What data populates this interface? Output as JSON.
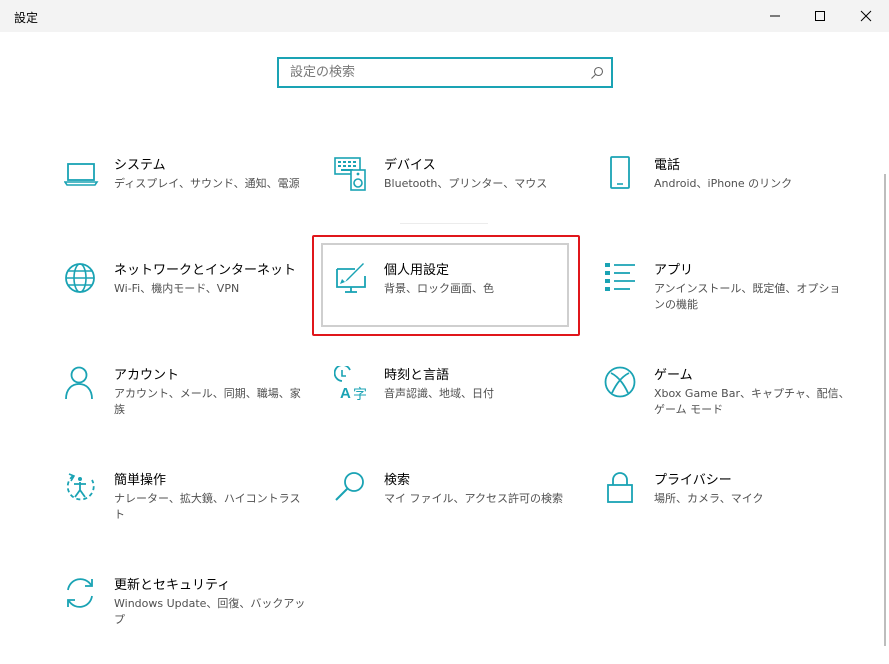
{
  "window": {
    "title": "設定",
    "minimize_icon": "minimize-icon",
    "maximize_icon": "maximize-icon",
    "close_icon": "close-icon"
  },
  "search": {
    "placeholder": "設定の検索",
    "value": "",
    "icon": "search-icon"
  },
  "accent_color": "#1aa3b4",
  "highlight_color": "#e0161b",
  "tiles": [
    {
      "title": "システム",
      "desc": "ディスプレイ、サウンド、通知、電源",
      "icon": "laptop-icon"
    },
    {
      "title": "デバイス",
      "desc": "Bluetooth、プリンター、マウス",
      "icon": "keyboard-speaker-icon"
    },
    {
      "title": "電話",
      "desc": "Android、iPhone のリンク",
      "icon": "phone-icon"
    },
    {
      "title": "ネットワークとインターネット",
      "desc": "Wi-Fi、機内モード、VPN",
      "icon": "globe-icon"
    },
    {
      "title": "個人用設定",
      "desc": "背景、ロック画面、色",
      "icon": "paint-brush-icon"
    },
    {
      "title": "アプリ",
      "desc": "アンインストール、既定値、オプションの機能",
      "icon": "apps-list-icon"
    },
    {
      "title": "アカウント",
      "desc": "アカウント、メール、同期、職場、家族",
      "icon": "person-icon"
    },
    {
      "title": "時刻と言語",
      "desc": "音声認識、地域、日付",
      "icon": "time-language-icon"
    },
    {
      "title": "ゲーム",
      "desc": "Xbox Game Bar、キャプチャ、配信、ゲーム モード",
      "icon": "xbox-icon"
    },
    {
      "title": "簡単操作",
      "desc": "ナレーター、拡大鏡、ハイコントラスト",
      "icon": "ease-of-access-icon"
    },
    {
      "title": "検索",
      "desc": "マイ ファイル、アクセス許可の検索",
      "icon": "magnifier-icon"
    },
    {
      "title": "プライバシー",
      "desc": "場所、カメラ、マイク",
      "icon": "lock-icon"
    },
    {
      "title": "更新とセキュリティ",
      "desc": "Windows Update、回復、バックアップ",
      "icon": "sync-icon"
    }
  ]
}
